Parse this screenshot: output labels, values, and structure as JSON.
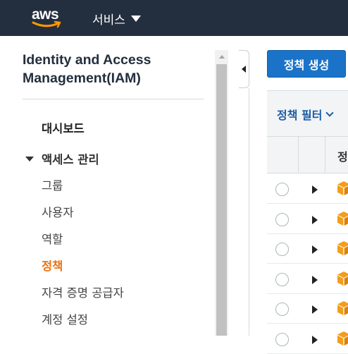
{
  "topbar": {
    "logo_text": "aws",
    "services_label": "서비스",
    "colors": {
      "background": "#232f3e",
      "smile": "#ff9900"
    }
  },
  "sidebar": {
    "title": "Identity and Access Management(IAM)",
    "dashboard": "대시보드",
    "access_management": {
      "label": "액세스 관리",
      "items": [
        {
          "label": "그룹",
          "active": false
        },
        {
          "label": "사용자",
          "active": false
        },
        {
          "label": "역할",
          "active": false
        },
        {
          "label": "정책",
          "active": true
        },
        {
          "label": "자격 증명 공급자",
          "active": false
        },
        {
          "label": "계정 설정",
          "active": false
        }
      ]
    },
    "colors": {
      "active": "#ec7211"
    }
  },
  "main": {
    "create_button_label": "정책 생성",
    "filter_label": "정책 필터",
    "table": {
      "column_headers": [
        "",
        "",
        "정"
      ],
      "rows": [
        {
          "icon": "policy-cube-icon"
        },
        {
          "icon": "policy-cube-icon"
        },
        {
          "icon": "policy-cube-icon"
        },
        {
          "icon": "policy-cube-icon"
        },
        {
          "icon": "policy-cube-icon"
        },
        {
          "icon": "policy-cube-icon"
        }
      ]
    },
    "colors": {
      "primary_button": "#1a73c8",
      "link": "#1a5da8",
      "cube": "#f29d1c"
    }
  }
}
